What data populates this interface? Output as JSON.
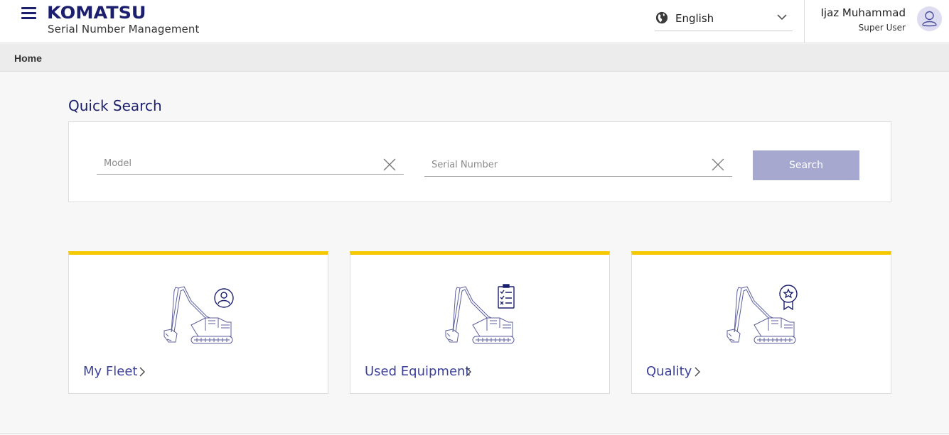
{
  "header": {
    "brand": "KOMATSU",
    "app_subtitle": "Serial Number Management",
    "language": {
      "selected": "English"
    },
    "user": {
      "name": "Ijaz Muhammad",
      "role": "Super User"
    }
  },
  "breadcrumb": {
    "items": [
      "Home"
    ]
  },
  "quick_search": {
    "title": "Quick Search",
    "model_placeholder": "Model",
    "serial_placeholder": "Serial Number",
    "model_value": "",
    "serial_value": "",
    "search_label": "Search"
  },
  "cards": [
    {
      "label": "My Fleet",
      "icon": "excavator-user-icon"
    },
    {
      "label": "Used Equipment",
      "icon": "excavator-checklist-icon"
    },
    {
      "label": "Quality",
      "icon": "excavator-award-icon"
    }
  ],
  "colors": {
    "brand": "#1b1f6e",
    "accent_yellow": "#f5c800",
    "link": "#3b3f9a",
    "button_disabled": "#a7a8cf",
    "page_bg": "#f7f7f7"
  }
}
